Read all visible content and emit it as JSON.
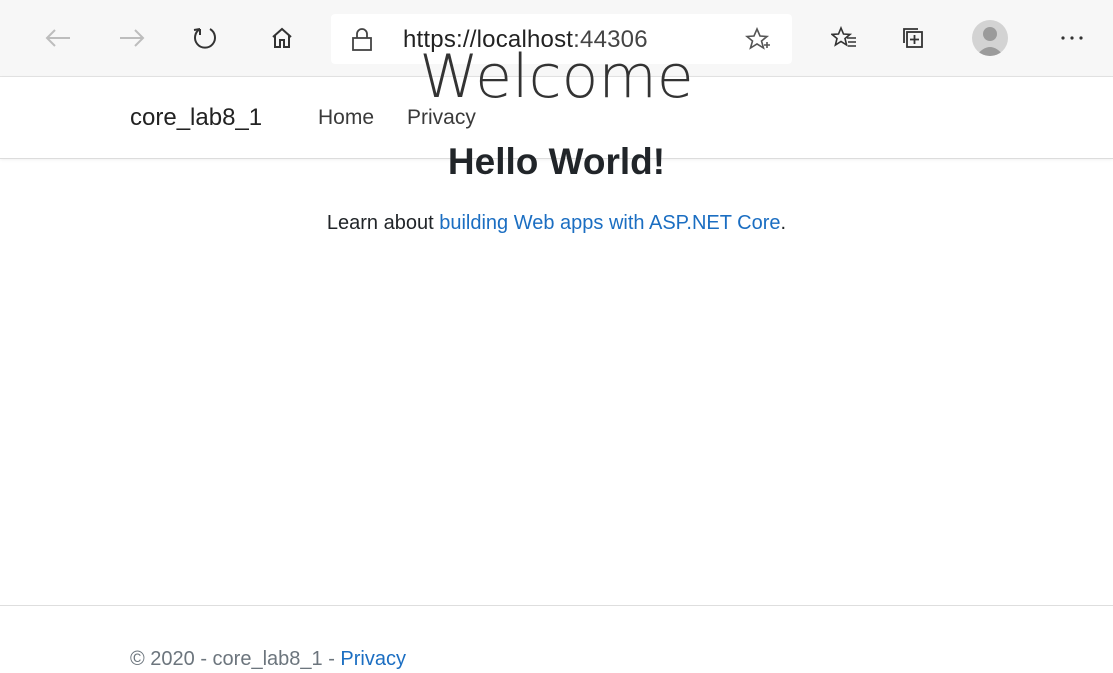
{
  "browser": {
    "url_scheme_host": "https://localhost",
    "url_port": ":44306"
  },
  "site": {
    "brand": "core_lab8_1",
    "nav": [
      "Home",
      "Privacy"
    ]
  },
  "main": {
    "title": "Welcome",
    "heading": "Hello World!",
    "learn_prefix": "Learn about ",
    "learn_link": "building Web apps with ASP.NET Core",
    "learn_suffix": "."
  },
  "footer": {
    "text": "© 2020 - core_lab8_1 - ",
    "link": "Privacy"
  },
  "colors": {
    "link": "#1b6ec2",
    "toolbar_bg": "#f7f7f7"
  }
}
